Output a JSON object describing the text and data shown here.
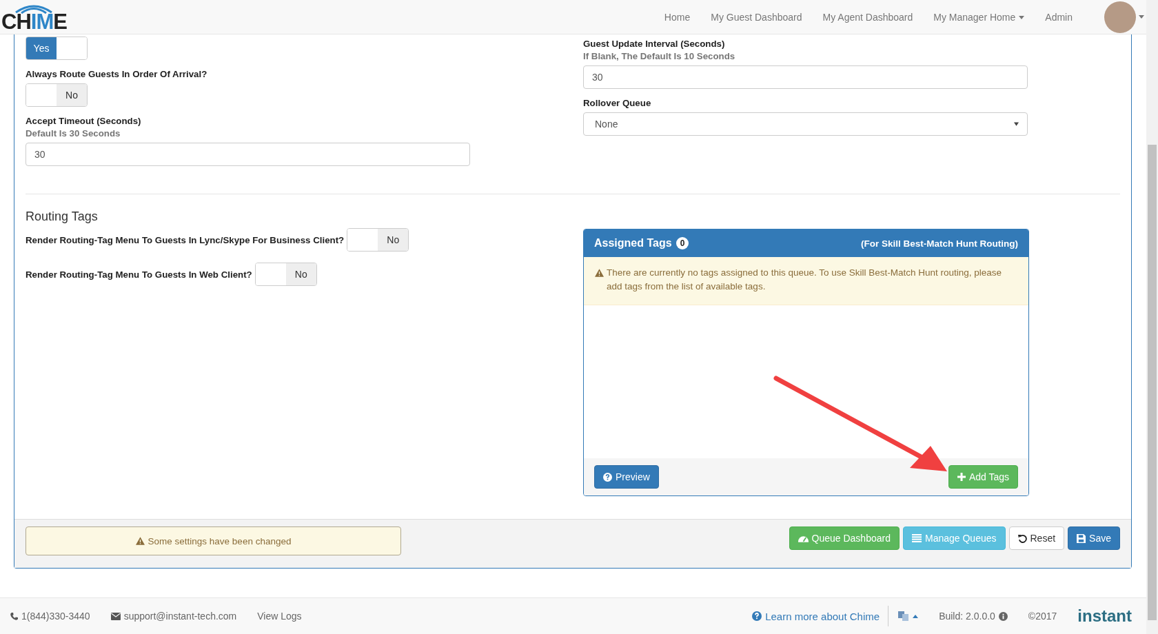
{
  "header": {
    "logo": [
      {
        "text": "CH",
        "accent": false
      },
      {
        "text": "IM",
        "accent": true
      },
      {
        "text": "E",
        "accent": false
      }
    ],
    "nav": [
      {
        "label": "Home",
        "dropdown": false
      },
      {
        "label": "My Guest Dashboard",
        "dropdown": false
      },
      {
        "label": "My Agent Dashboard",
        "dropdown": false
      },
      {
        "label": "My Manager Home",
        "dropdown": true
      },
      {
        "label": "Admin",
        "dropdown": false
      }
    ]
  },
  "left": {
    "top_toggle": {
      "label": "Yes",
      "on": true
    },
    "fields": [
      {
        "kind": "toggle",
        "label": "Always Route Guests In Order Of Arrival?",
        "toggle": {
          "label": "No",
          "on": false
        }
      },
      {
        "kind": "input",
        "label": "Accept Timeout (Seconds)",
        "hint": "Default Is 30 Seconds",
        "value": "30"
      }
    ]
  },
  "right": {
    "fields": [
      {
        "kind": "input",
        "label": "Guest Update Interval (Seconds)",
        "hint": "If Blank, The Default Is 10 Seconds",
        "value": "30"
      },
      {
        "kind": "select",
        "label": "Rollover Queue",
        "value": "None"
      }
    ]
  },
  "routing": {
    "title": "Routing Tags",
    "options": [
      {
        "label": "Render Routing-Tag Menu To Guests In Lync/Skype For Business Client?",
        "toggle": {
          "label": "No",
          "on": false
        }
      },
      {
        "label": "Render Routing-Tag Menu To Guests In Web Client?",
        "toggle": {
          "label": "No",
          "on": false
        }
      }
    ],
    "assigned": {
      "title": "Assigned Tags",
      "count": "0",
      "note": "(For Skill Best-Match Hunt Routing)",
      "warning": "There are currently no tags assigned to this queue. To use Skill Best-Match Hunt routing, please add tags from the list of available tags.",
      "preview": "Preview",
      "add": "Add Tags"
    }
  },
  "status": {
    "message": "Some settings have been changed"
  },
  "actions": [
    {
      "label": "Queue Dashboard",
      "kind": "dashboard"
    },
    {
      "label": "Manage Queues",
      "kind": "manage"
    },
    {
      "label": "Reset",
      "kind": "reset"
    },
    {
      "label": "Save",
      "kind": "save"
    }
  ],
  "footer": {
    "phone": "1(844)330-3440",
    "email": "support@instant-tech.com",
    "logs": "View Logs",
    "learn": "Learn more about Chime",
    "build": "Build: 2.0.0.0",
    "copyright": "©2017",
    "brand": "instant"
  }
}
